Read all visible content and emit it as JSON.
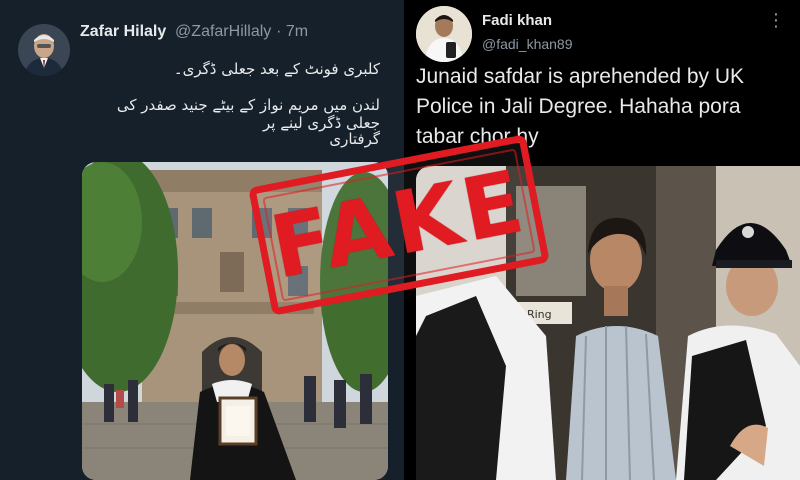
{
  "left_tweet": {
    "author_name": "Zafar Hilaly",
    "handle": "@ZafarHillaly",
    "time": "· 7m",
    "lines": [
      "کلبری فونٹ کے بعد جعلی ڈگری۔",
      "لندن میں مریم نواز کے بیٹے جنید صفدر کی جعلی ڈگری لینے پر",
      "گرفتاری"
    ],
    "photo": "graduation-photo"
  },
  "right_tweet": {
    "author_name": "Fadi khan",
    "handle": "@fadi_khan89",
    "more_icon": "more-vertical-icon",
    "text": "Junaid safdar is aprehended by UK Police in Jali Degree. Hahaha pora tabar chor hy",
    "photo": "police-photo",
    "sign_text": "arass Ring"
  },
  "stamp": {
    "label": "FAKE",
    "color": "#e11b22"
  },
  "colors": {
    "left_bg": "#15202b",
    "right_bg": "#000000",
    "text_primary": "#e7e9ea",
    "text_secondary": "#8b98a5"
  }
}
